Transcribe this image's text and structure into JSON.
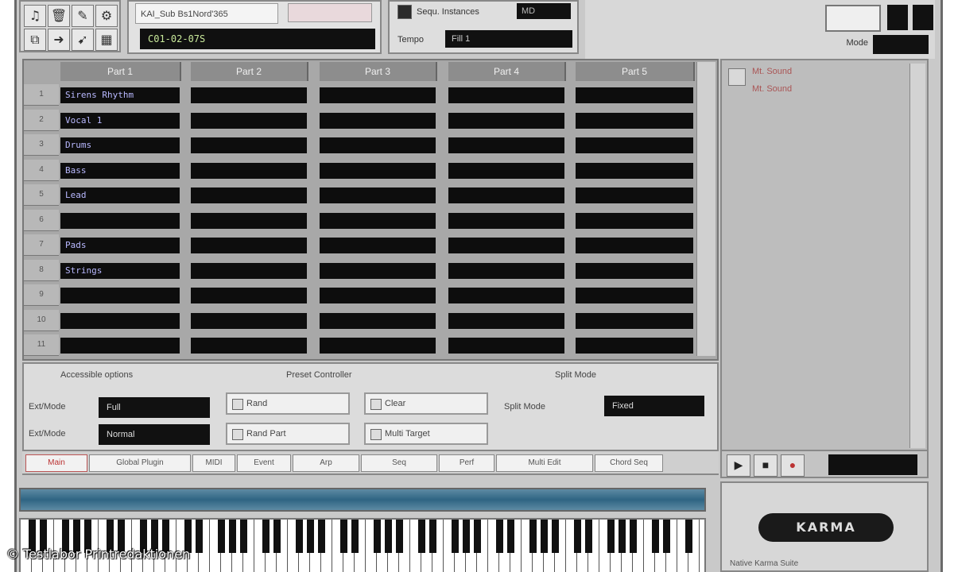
{
  "top": {
    "patch_name": "KAI_Sub Bs1Nord'365",
    "patch_display": "C01-02-07S",
    "option_label": "Sequ. Instances",
    "option_value": "MD",
    "option2_label": "Tempo",
    "option2_value": "Fill 1",
    "top_right_label": "Mode"
  },
  "grid": {
    "columns": [
      "Part 1",
      "Part 2",
      "Part 3",
      "Part 4",
      "Part 5"
    ],
    "rows": [
      {
        "num": "1",
        "cells": [
          "Sirens Rhythm",
          "",
          "",
          "",
          ""
        ]
      },
      {
        "num": "2",
        "cells": [
          "Vocal 1",
          "",
          "",
          "",
          ""
        ]
      },
      {
        "num": "3",
        "cells": [
          "Drums",
          "",
          "",
          "",
          ""
        ]
      },
      {
        "num": "4",
        "cells": [
          "Bass",
          "",
          "",
          "",
          ""
        ]
      },
      {
        "num": "5",
        "cells": [
          "Lead",
          "",
          "",
          "",
          ""
        ]
      },
      {
        "num": "6",
        "cells": [
          "",
          "",
          "",
          "",
          ""
        ]
      },
      {
        "num": "7",
        "cells": [
          "Pads",
          "",
          "",
          "",
          ""
        ]
      },
      {
        "num": "8",
        "cells": [
          "Strings",
          "",
          "",
          "",
          ""
        ]
      },
      {
        "num": "9",
        "cells": [
          "",
          "",
          "",
          "",
          ""
        ]
      },
      {
        "num": "10",
        "cells": [
          "",
          "",
          "",
          "",
          ""
        ]
      },
      {
        "num": "11",
        "cells": [
          "",
          "",
          "",
          "",
          ""
        ]
      }
    ]
  },
  "side": {
    "item1": "Mt. Sound",
    "item2": "Mt. Sound"
  },
  "controls": {
    "section1": "Accessible options",
    "section2": "Preset Controller",
    "section3": "Split Mode",
    "label_a": "Ext/Mode",
    "label_b": "Ext/Mode",
    "select_a": "Full",
    "select_b": "Normal",
    "btn_1": "Rand",
    "btn_2": "Clear",
    "btn_3": "Rand Part",
    "btn_4": "Multi Target",
    "label_c": "Split Mode",
    "select_c": "Fixed"
  },
  "tabs": [
    {
      "label": "Main",
      "active": true
    },
    {
      "label": "Global Plugin"
    },
    {
      "label": "MIDI"
    },
    {
      "label": "Event"
    },
    {
      "label": "Arp"
    },
    {
      "label": "Seq"
    },
    {
      "label": "Perf"
    },
    {
      "label": "Multi Edit"
    },
    {
      "label": "Chord Seq"
    }
  ],
  "progress": {
    "value": 1.0
  },
  "logo": {
    "text": "KARMA",
    "caption": "Native Karma Suite"
  },
  "credit": "© Testlabor Printredaktionen",
  "icons": {
    "tool_1": "note-icon",
    "tool_2": "trash-icon",
    "tool_3": "pencil-icon",
    "tool_4": "gear-icon",
    "tool_5": "cursor-icon",
    "side": "folder-icon",
    "rt_1": "play-icon",
    "rt_2": "stop-icon",
    "rt_3": "record-icon"
  }
}
